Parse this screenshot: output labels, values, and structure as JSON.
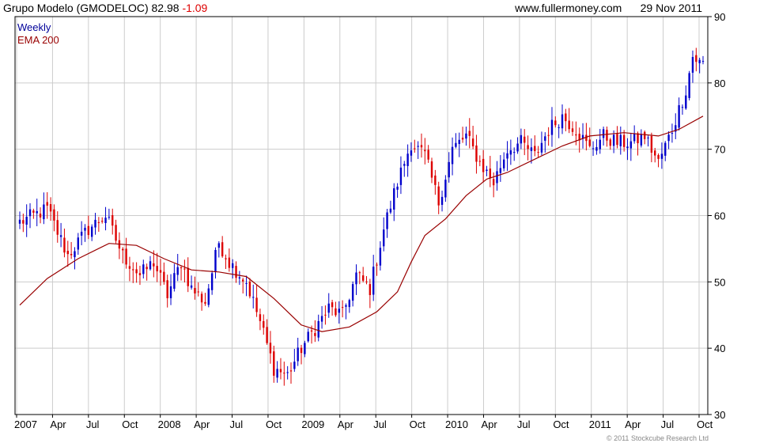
{
  "header": {
    "name_ticker": "Grupo Modelo (GMODELOC)",
    "last": "82.98",
    "change": "-1.09",
    "site": "www.fullermoney.com",
    "date": "29 Nov 2011"
  },
  "copyright": "© 2011 Stockcube Research Ltd",
  "chart_data": {
    "type": "candlestick",
    "title": "Grupo Modelo (GMODELOC) 82.98 -1.09",
    "legend": [
      "Weekly",
      "EMA 200"
    ],
    "ylim": [
      30,
      90
    ],
    "y_ticks": [
      30,
      40,
      50,
      60,
      70,
      80,
      90
    ],
    "x_ticks": [
      "2007",
      "Apr",
      "Jul",
      "Oct",
      "2008",
      "Apr",
      "Jul",
      "Oct",
      "2009",
      "Apr",
      "Jul",
      "Oct",
      "2010",
      "Apr",
      "Jul",
      "Oct",
      "2011",
      "Apr",
      "Jul",
      "Oct"
    ],
    "grid": true,
    "colors": {
      "up": "#0000cc",
      "down": "#dd0000",
      "ema": "#990000",
      "grid": "#cccccc",
      "weekly_label": "#000099",
      "ema_label": "#990000"
    },
    "series": [
      {
        "name": "Weekly",
        "interval": "weekly",
        "anchors": [
          [
            0,
            59
          ],
          [
            8,
            61
          ],
          [
            14,
            54
          ],
          [
            20,
            58
          ],
          [
            25,
            60
          ],
          [
            30,
            54
          ],
          [
            35,
            51
          ],
          [
            39,
            53
          ],
          [
            43,
            48
          ],
          [
            47,
            53
          ],
          [
            50,
            49
          ],
          [
            54,
            47
          ],
          [
            58,
            56
          ],
          [
            61,
            53
          ],
          [
            66,
            50
          ],
          [
            70,
            44
          ],
          [
            74,
            37
          ],
          [
            78,
            36
          ],
          [
            82,
            40
          ],
          [
            86,
            43
          ],
          [
            90,
            46
          ],
          [
            94,
            45
          ],
          [
            98,
            51
          ],
          [
            102,
            49
          ],
          [
            106,
            58
          ],
          [
            110,
            65
          ],
          [
            114,
            71
          ],
          [
            118,
            69
          ],
          [
            122,
            62
          ],
          [
            126,
            70
          ],
          [
            130,
            72
          ],
          [
            134,
            68
          ],
          [
            138,
            65
          ],
          [
            142,
            70
          ],
          [
            146,
            71
          ],
          [
            150,
            69
          ],
          [
            154,
            73
          ],
          [
            158,
            75
          ],
          [
            162,
            73
          ],
          [
            166,
            70
          ],
          [
            170,
            72
          ],
          [
            174,
            71
          ],
          [
            178,
            71
          ],
          [
            182,
            72
          ],
          [
            186,
            68
          ],
          [
            190,
            73
          ],
          [
            194,
            79
          ],
          [
            196,
            84
          ],
          [
            198,
            83
          ]
        ]
      },
      {
        "name": "EMA 200",
        "values": [
          [
            0,
            46.5
          ],
          [
            8,
            50.5
          ],
          [
            17,
            53.5
          ],
          [
            26,
            55.8
          ],
          [
            34,
            55.5
          ],
          [
            42,
            53.5
          ],
          [
            50,
            51.8
          ],
          [
            58,
            51.5
          ],
          [
            66,
            50.8
          ],
          [
            74,
            47.5
          ],
          [
            82,
            43.5
          ],
          [
            88,
            42.5
          ],
          [
            96,
            43.2
          ],
          [
            104,
            45.5
          ],
          [
            110,
            48.5
          ],
          [
            114,
            53
          ],
          [
            118,
            57
          ],
          [
            124,
            59.5
          ],
          [
            130,
            63
          ],
          [
            136,
            65.5
          ],
          [
            142,
            66.5
          ],
          [
            150,
            68.5
          ],
          [
            158,
            70.5
          ],
          [
            166,
            72
          ],
          [
            176,
            72.5
          ],
          [
            186,
            72
          ],
          [
            192,
            73
          ],
          [
            199,
            75
          ]
        ]
      }
    ]
  }
}
